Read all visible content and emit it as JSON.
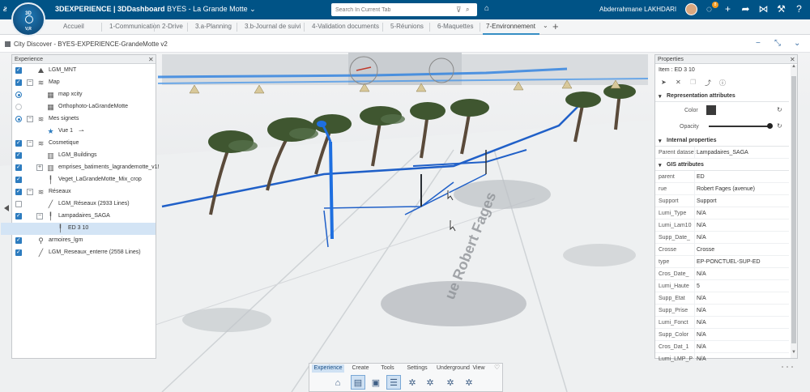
{
  "topbar": {
    "compass_top": "3D",
    "compass_bottom": "V,R",
    "brand": "3DEXPERIENCE | 3DDashboard",
    "dashboard": "BYES - La Grande Motte",
    "search_placeholder": "Search In Current Tab",
    "user_name": "Abderrahmane LAKHDARI",
    "notification_count": "8"
  },
  "tabs": [
    {
      "label": "Accueil"
    },
    {
      "label": "1-Communication"
    },
    {
      "label": "2-Drive"
    },
    {
      "label": "3.a-Planning"
    },
    {
      "label": "3.b-Journal de suivi"
    },
    {
      "label": "4-Validation documents"
    },
    {
      "label": "5-Réunions"
    },
    {
      "label": "6-Maquettes"
    },
    {
      "label": "7-Environnement",
      "active": true
    }
  ],
  "widget": {
    "title": "City Discover - BYES-EXPERIENCE-GrandeMotte v2"
  },
  "experience_panel": {
    "title": "Experience",
    "items": [
      {
        "label": "LGM_MNT",
        "icon": "terrain-icon",
        "check": "on",
        "level": 0
      },
      {
        "label": "Map",
        "icon": "layers-icon",
        "check": "on",
        "level": 0,
        "expander": "−"
      },
      {
        "label": "map xcity",
        "icon": "map-tile-icon",
        "check": "radio-on",
        "level": 1
      },
      {
        "label": "Orthophoto-LaGrandeMotte",
        "icon": "map-tile-icon",
        "check": "radio-off",
        "level": 1
      },
      {
        "label": "Mes signets",
        "icon": "layers-icon",
        "check": "radio-on",
        "level": 0,
        "expander": "−"
      },
      {
        "label": "Vue 1",
        "icon": "star-icon",
        "check": "none",
        "level": 1
      },
      {
        "label": "Cosmetique",
        "icon": "layers-icon",
        "check": "on",
        "level": 0,
        "expander": "−"
      },
      {
        "label": "LGM_Buildings",
        "icon": "buildings-icon",
        "check": "on",
        "level": 1
      },
      {
        "label": "emprises_batiments_lagrandemotte_v1!",
        "icon": "buildings-icon",
        "check": "on",
        "level": 1,
        "expander": "+"
      },
      {
        "label": "Veget_LaGrandeMotte_Mix_crop",
        "icon": "lamp-icon",
        "check": "on",
        "level": 1
      },
      {
        "label": "Réseaux",
        "icon": "layers-icon",
        "check": "on",
        "level": 0,
        "expander": "−"
      },
      {
        "label": "LGM_Réseaux (2933 Lines)",
        "icon": "line-icon",
        "check": "off",
        "level": 1
      },
      {
        "label": "Lampadaires_SAGA",
        "icon": "lamp-icon",
        "check": "on",
        "level": 1,
        "expander": "−"
      },
      {
        "label": "ED 3 10",
        "icon": "lamp-icon",
        "check": "none",
        "level": 2,
        "selected": true
      },
      {
        "label": "armoires_lgm",
        "icon": "pin-icon",
        "check": "on",
        "level": 0
      },
      {
        "label": "LGM_Reseaux_enterre (2558 Lines)",
        "icon": "line-icon",
        "check": "on",
        "level": 0
      }
    ]
  },
  "properties_panel": {
    "title": "Properties",
    "item_label": "Item : ED 3 10",
    "section_representation": "Representation attributes",
    "color_label": "Color",
    "color_value": "#3a3a3a",
    "opacity_label": "Opacity",
    "opacity_value": 1.0,
    "section_internal": "Internal properties",
    "internal": [
      {
        "key": "Parent dataset",
        "value": "Lampadaires_SAGA"
      }
    ],
    "section_gis": "GIS attributes",
    "gis": [
      {
        "key": "parent",
        "value": "ED"
      },
      {
        "key": "rue",
        "value": "Robert Fages (avenue)"
      },
      {
        "key": "Support",
        "value": "Support"
      },
      {
        "key": "Lumi_Type",
        "value": "N/A"
      },
      {
        "key": "Lumi_Lam10",
        "value": "N/A"
      },
      {
        "key": "Supp_Date_",
        "value": "N/A"
      },
      {
        "key": "Crosse",
        "value": "Crosse"
      },
      {
        "key": "type",
        "value": "EP-PONCTUEL-SUP-ED"
      },
      {
        "key": "Cros_Date_",
        "value": "N/A"
      },
      {
        "key": "Lumi_Haute",
        "value": "5"
      },
      {
        "key": "Supp_Etat",
        "value": "N/A"
      },
      {
        "key": "Supp_Prise",
        "value": "N/A"
      },
      {
        "key": "Lumi_Fonct",
        "value": "N/A"
      },
      {
        "key": "Supp_Color",
        "value": "N/A"
      },
      {
        "key": "Cros_Dat_1",
        "value": "N/A"
      },
      {
        "key": "Lumi_LMP_P",
        "value": "N/A"
      }
    ]
  },
  "scene": {
    "street_label": "ue Robert Fages"
  },
  "toolbar": {
    "tabs": [
      {
        "label": "Experience",
        "active": true
      },
      {
        "label": "Create"
      },
      {
        "label": "Tools"
      },
      {
        "label": "Settings"
      },
      {
        "label": "Underground"
      },
      {
        "label": "View"
      }
    ],
    "buttons": [
      {
        "name": "home-view-button",
        "icon": "⌂"
      },
      {
        "name": "experience-panel-button",
        "icon": "▤",
        "selected": true
      },
      {
        "name": "image-layer-button",
        "icon": "▣"
      },
      {
        "name": "properties-panel-button",
        "icon": "☰",
        "selected": true
      },
      {
        "name": "tool-a-button",
        "icon": "✲"
      },
      {
        "name": "tool-b-button",
        "icon": "✲"
      },
      {
        "name": "tool-c-button",
        "icon": "✲"
      },
      {
        "name": "tool-d-button",
        "icon": "✲"
      }
    ]
  }
}
